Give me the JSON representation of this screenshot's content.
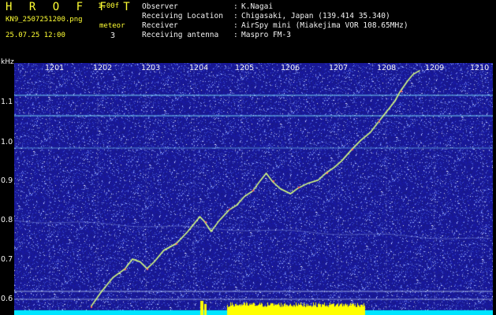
{
  "header": {
    "logo": "H R O F F T",
    "version": "1.00f",
    "filename": "KN9_2507251200.png",
    "meteor_label": "meteor",
    "meteor_count": "3",
    "datetime": "25.07.25 12:00"
  },
  "info": [
    {
      "key": "Observer",
      "value": "K.Nagai"
    },
    {
      "key": "Receiving Location",
      "value": "Chigasaki, Japan (139.414 35.340)"
    },
    {
      "key": "Receiver",
      "value": "AirSpy mini (Miakejima VOR 108.65MHz)"
    },
    {
      "key": "Receiving antenna",
      "value": "Maspro FM-3"
    }
  ],
  "spectrogram": {
    "freq_unit": "kHz",
    "time_ticks": [
      "1201",
      "1202",
      "1203",
      "1204",
      "1205",
      "1206",
      "1207",
      "1208",
      "1209",
      "1210"
    ],
    "freq_ticks": [
      "1.1",
      "1.0",
      "0.9",
      "0.8",
      "0.7",
      "0.6"
    ],
    "colors": {
      "background": "#1a1a8c",
      "trace": "#d8ff80",
      "carrier": "#7fe8ff",
      "power_bar": "#00e5ff",
      "burst": "#ffff00"
    }
  }
}
